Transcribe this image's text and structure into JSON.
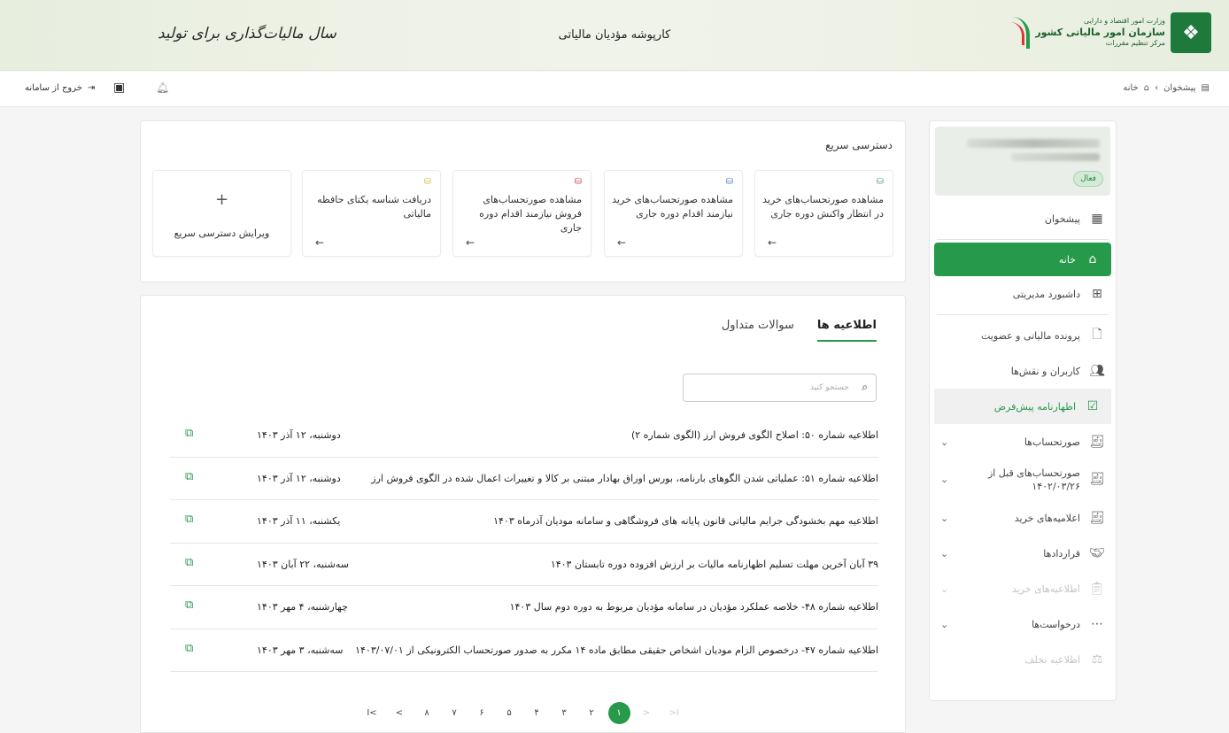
{
  "header": {
    "title": "کارپوشه مؤدیان مالیاتی",
    "motto": "سال مالیات‌گذاری برای تولید",
    "logo": {
      "line1": "وزارت امور اقتصاد و دارایی",
      "line2": "سازمان امور مالیاتی کشور",
      "line3": "مرکز تنظیم مقررات"
    }
  },
  "toolbar": {
    "breadcrumb": [
      "پیشخوان",
      "خانه"
    ],
    "exit_label": "خروج از سامانه"
  },
  "sidebar": {
    "status": "فعال",
    "items": [
      {
        "label": "پیشخوان",
        "icon": "dashboard-grid-icon"
      },
      {
        "label": "خانه",
        "icon": "home-icon"
      },
      {
        "label": "داشبورد مدیریتی",
        "icon": "apps-icon"
      },
      {
        "label": "پرونده مالیاتی و عضویت",
        "icon": "file-icon"
      },
      {
        "label": "کاربران و نقش‌ها",
        "icon": "users-icon"
      },
      {
        "label": "اظهارنامه پیش‌فرض",
        "icon": "checklist-icon"
      },
      {
        "label": "صورتحساب‌ها",
        "icon": "receipt-icon"
      },
      {
        "label": "صورتحساب‌های قبل از ۱۴۰۲/۰۳/۲۶",
        "icon": "receipt-icon"
      },
      {
        "label": "اعلامیه‌های خرید",
        "icon": "receipt-icon"
      },
      {
        "label": "قراردادها",
        "icon": "handshake-icon"
      },
      {
        "label": "اطلاعیه‌های خرید",
        "icon": "clipboard-icon"
      },
      {
        "label": "درخواست‌ها",
        "icon": "message-icon"
      },
      {
        "label": "اطلاعیه تخلف",
        "icon": "gavel-icon"
      }
    ]
  },
  "quick_access": {
    "title": "دسترسی سریع",
    "cards": [
      {
        "label": "مشاهده صورتحساب‌های خرید در انتظار واکنش دوره جاری",
        "coin_color": "#5aa06e"
      },
      {
        "label": "مشاهده صورتحساب‌های خرید نیازمند اقدام دوره جاری",
        "coin_color": "#4a7ab8"
      },
      {
        "label": "مشاهده صورتحساب‌های فروش نیازمند اقدام دوره جاری",
        "coin_color": "#c0443f"
      },
      {
        "label": "دریافت شناسه یکتای حافظه مالیاتی",
        "coin_color": "#d9b93a"
      }
    ],
    "edit_label": "ویرایش دسترسی سریع"
  },
  "news": {
    "tabs": [
      "اطلاعیه ها",
      "سوالات متداول"
    ],
    "search_placeholder": "جستجو کنید",
    "rows": [
      {
        "title": "اطلاعیه شماره ۵۰: اصلاح الگوی فروش ارز (الگوی شماره ۲)",
        "date": "دوشنبه، ۱۲ آذر ۱۴۰۳"
      },
      {
        "title": "اطلاعیه شماره ۵۱: عملیاتی شدن الگوهای بارنامه، بورس اوراق بهادار مبتنی بر کالا و تغییرات اعمال شده در الگوی فروش ارز",
        "date": "دوشنبه، ۱۲ آذر ۱۴۰۳"
      },
      {
        "title": "اطلاعیه مهم بخشودگی جرایم مالیاتی قانون پایانه های فروشگاهی و سامانه مودیان آذرماه ۱۴۰۳",
        "date": "یکشنبه، ۱۱ آذر ۱۴۰۳"
      },
      {
        "title": "۳۹ آبان آخرین مهلت تسلیم اظهارنامه مالیات بر ارزش افزوده دوره تابستان ۱۴۰۳",
        "date": "سه‌شنبه، ۲۲ آبان ۱۴۰۳"
      },
      {
        "title": "اطلاعیه شماره ۴۸- خلاصه عملکرد مؤدیان در سامانه مؤدیان مربوط به دوره دوم سال ۱۴۰۳",
        "date": "چهارشنبه، ۴ مهر ۱۴۰۳"
      },
      {
        "title": "اطلاعیه شماره ۴۷- درخصوص الزام مودیان اشخاص حقیقی مطابق ماده ۱۴ مکرر به صدور صورتحساب الکترونیکی از ۱۴۰۳/۰۷/۰۱",
        "date": "سه‌شنبه، ۳ مهر ۱۴۰۳"
      }
    ]
  },
  "pagination": {
    "first": ">I",
    "prev": ">",
    "pages": [
      "۱",
      "۲",
      "۳",
      "۴",
      "۵",
      "۶",
      "۷",
      "۸"
    ],
    "current": "۱",
    "next": "<",
    "last": "I<"
  }
}
